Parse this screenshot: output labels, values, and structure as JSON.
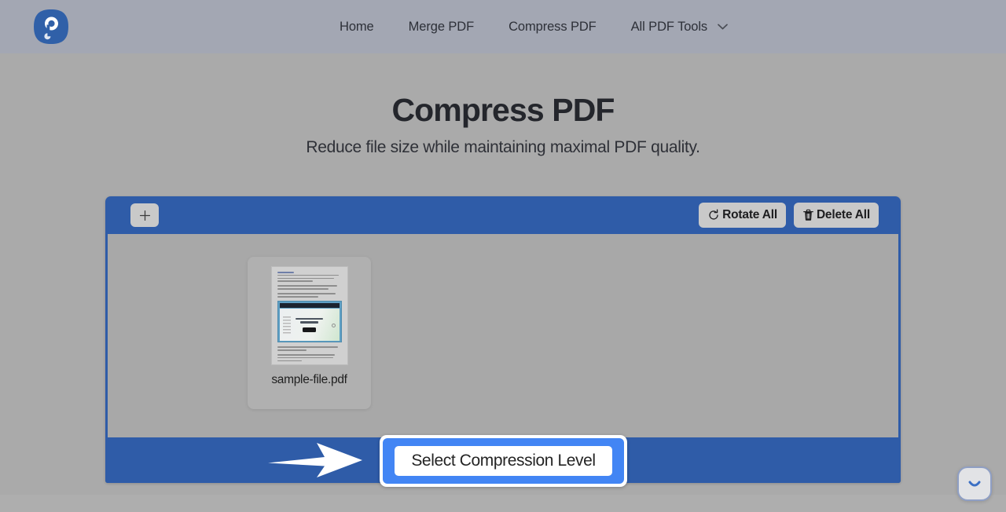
{
  "colors": {
    "header_bg": "#a3a7b3",
    "page_bg": "#aaaaaa",
    "panel_blue": "#2f5ca8",
    "highlight_blue": "#4285f4",
    "logo_blue": "#3060a8",
    "button_gray": "#c9c9c9"
  },
  "header": {
    "logo_icon": "pdf-logo-icon",
    "nav": [
      {
        "label": "Home",
        "icon": null
      },
      {
        "label": "Merge PDF",
        "icon": null
      },
      {
        "label": "Compress PDF",
        "icon": null
      },
      {
        "label": "All PDF Tools",
        "icon": "chevron-down-icon"
      }
    ]
  },
  "hero": {
    "title": "Compress PDF",
    "subtitle": "Reduce file size while maintaining maximal PDF quality."
  },
  "panel": {
    "toolbar": {
      "add_label": "+",
      "add_icon": "plus-icon",
      "rotate_all_label": "Rotate All",
      "rotate_all_icon": "rotate-icon",
      "delete_all_label": "Delete All",
      "delete_all_icon": "trash-icon"
    },
    "files": [
      {
        "name": "sample-file.pdf",
        "thumbnail": "document-page-preview"
      }
    ],
    "footer": {
      "arrow_icon": "right-arrow-annotation",
      "cta_label": "Select Compression Level"
    }
  },
  "chat": {
    "icon": "chat-smiley-icon"
  }
}
